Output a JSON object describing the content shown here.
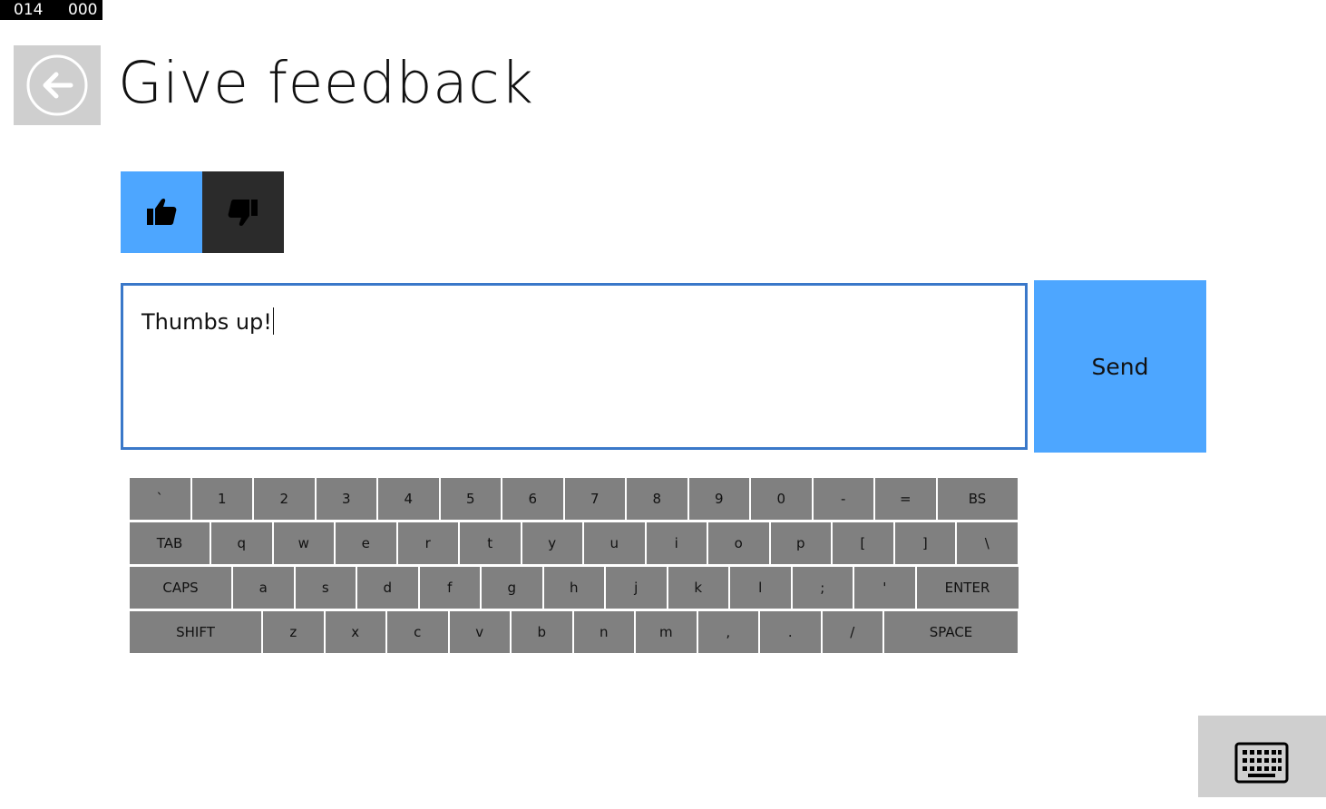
{
  "counter": {
    "left": "014",
    "right": "000"
  },
  "header": {
    "back_icon": "arrow-left-circle-icon",
    "title": "Give feedback"
  },
  "rating": {
    "up_icon": "thumbs-up-icon",
    "down_icon": "thumbs-down-icon",
    "selected": "up"
  },
  "feedback": {
    "value": "Thumbs up!"
  },
  "send": {
    "label": "Send"
  },
  "keyboard": {
    "rows": [
      [
        "`",
        "1",
        "2",
        "3",
        "4",
        "5",
        "6",
        "7",
        "8",
        "9",
        "0",
        "-",
        "=",
        "BS"
      ],
      [
        "TAB",
        "q",
        "w",
        "e",
        "r",
        "t",
        "y",
        "u",
        "i",
        "o",
        "p",
        "[",
        "]",
        "\\"
      ],
      [
        "CAPS",
        "a",
        "s",
        "d",
        "f",
        "g",
        "h",
        "j",
        "k",
        "l",
        ";",
        "'",
        "ENTER"
      ],
      [
        "SHIFT",
        "z",
        "x",
        "c",
        "v",
        "b",
        "n",
        "m",
        ",",
        ".",
        "/",
        "SPACE"
      ]
    ]
  },
  "keyboard_toggle": {
    "icon": "keyboard-icon"
  },
  "colors": {
    "accent": "#4da6ff",
    "dark": "#2b2b2b",
    "key": "#808080",
    "input_border": "#3a78c9",
    "tile": "#cfcfcf"
  }
}
